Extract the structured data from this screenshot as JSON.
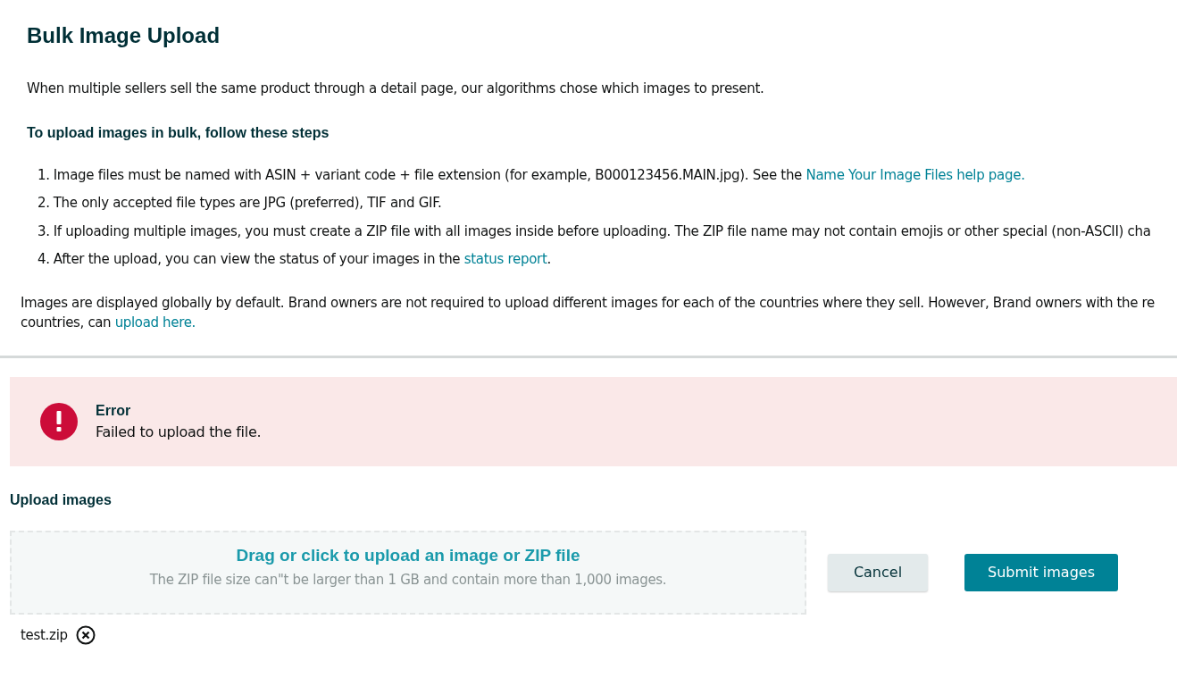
{
  "title": "Bulk Image Upload",
  "intro": "When multiple sellers sell the same product through a detail page, our algorithms chose which images to present.",
  "steps_heading": "To upload images in bulk, follow these steps",
  "steps": [
    {
      "number": "1.",
      "text": "Image files must be named with ASIN + variant code + file extension (for example, B000123456.MAIN.jpg). See the ",
      "link": "Name Your Image Files help page."
    },
    {
      "number": "2.",
      "text": "The only accepted file types are JPG (preferred), TIF and GIF."
    },
    {
      "number": "3.",
      "text": "If uploading multiple images, you must create a ZIP file with all images inside before uploading. The ZIP file name may not contain emojis or other special (non-ASCII) cha"
    },
    {
      "number": "4.",
      "text": "After the upload, you can view the status of your images in the ",
      "link": "status report",
      "after": "."
    }
  ],
  "note": {
    "line_1": "Images are displayed globally by default. Brand owners are not required to upload different images for each of the countries where they sell. However, Brand owners with the re",
    "line_2": "countries, can ",
    "link": "upload here."
  },
  "alert": {
    "kind": "error",
    "title": "Error",
    "message": "Failed to upload the file."
  },
  "upload": {
    "label": "Upload images",
    "drop_title": "Drag or click to upload an image or ZIP file",
    "drop_hint": "The ZIP file size can\"t be larger than 1 GB and contain more than 1,000 images.",
    "cancel": "Cancel",
    "submit": "Submit images",
    "files": [
      "test.zip"
    ]
  }
}
